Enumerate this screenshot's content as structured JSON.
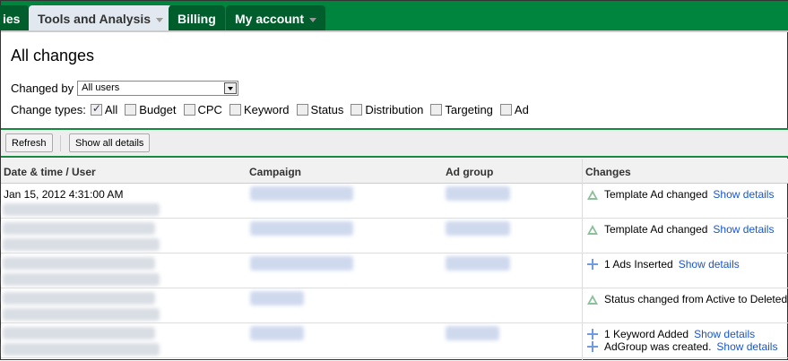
{
  "tabs": [
    {
      "label": "ies"
    },
    {
      "label": "Tools and Analysis"
    },
    {
      "label": "Billing"
    },
    {
      "label": "My account"
    }
  ],
  "page_title": "All changes",
  "changed_by": {
    "label": "Changed by",
    "value": "All users"
  },
  "change_types": {
    "label": "Change types:",
    "options": [
      {
        "label": "All",
        "checked": true
      },
      {
        "label": "Budget",
        "checked": false
      },
      {
        "label": "CPC",
        "checked": false
      },
      {
        "label": "Keyword",
        "checked": false
      },
      {
        "label": "Status",
        "checked": false
      },
      {
        "label": "Distribution",
        "checked": false
      },
      {
        "label": "Targeting",
        "checked": false
      },
      {
        "label": "Ad",
        "checked": false
      }
    ]
  },
  "toolbar": {
    "refresh": "Refresh",
    "show_all": "Show all details"
  },
  "columns": [
    "Date & time / User",
    "Campaign",
    "Ad group",
    "Changes"
  ],
  "rows": [
    {
      "date": "Jan 15, 2012 4:31:00 AM",
      "changes": [
        {
          "icon": "triangle-icon",
          "text": "Template Ad changed",
          "link": "Show details"
        }
      ]
    },
    {
      "date": "",
      "changes": [
        {
          "icon": "triangle-icon",
          "text": "Template Ad changed",
          "link": "Show details"
        }
      ]
    },
    {
      "date": "",
      "changes": [
        {
          "icon": "plus-icon",
          "text": "1 Ads Inserted",
          "link": "Show details"
        }
      ]
    },
    {
      "date": "",
      "changes": [
        {
          "icon": "triangle-icon",
          "text": "Status changed from Active to Deleted",
          "link": ""
        }
      ]
    },
    {
      "date": "",
      "changes": [
        {
          "icon": "plus-icon",
          "text": "1 Keyword Added",
          "link": "Show details"
        },
        {
          "icon": "plus-icon",
          "text": "AdGroup was created.",
          "link": "Show details"
        }
      ]
    }
  ]
}
